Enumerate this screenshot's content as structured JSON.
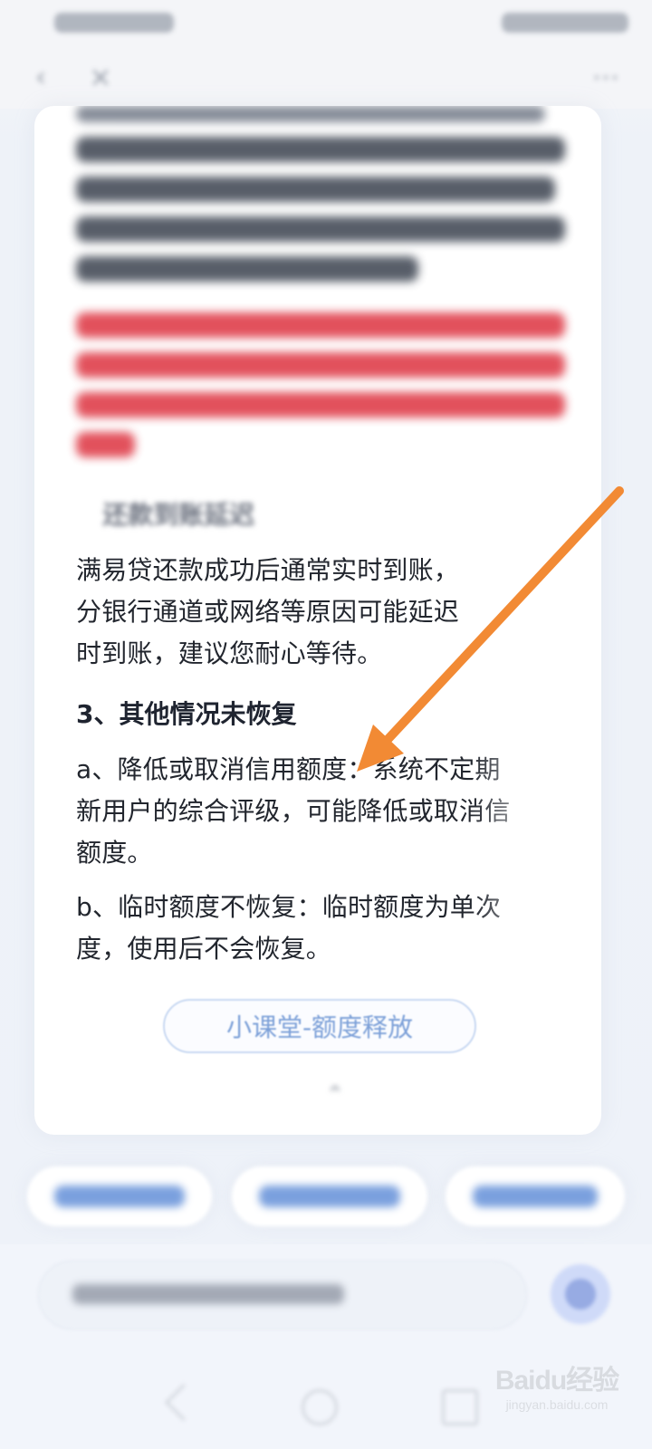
{
  "article": {
    "section_heading": "还款到账延迟",
    "delay_text": [
      "满易贷还款成功后通常实时到账，",
      "分银行通道或网络等原因可能延迟",
      "时到账，建议您耐心等待。"
    ],
    "other_heading": "3、其他情况未恢复",
    "items": [
      {
        "lines": [
          "a、降低或取消信用额度：系统不定期",
          "新用户的综合评级，可能降低或取消信",
          "额度。"
        ]
      },
      {
        "lines": [
          "b、临时额度不恢复：临时额度为单次",
          "度，使用后不会恢复。"
        ]
      }
    ],
    "pill_button": "小课堂-额度释放"
  },
  "watermark": {
    "logo": "Baidu经验",
    "sub": "jingyan.baidu.com"
  },
  "colors": {
    "accent_orange": "#f28a34",
    "link_blue": "#7ca0d8",
    "blurred_red": "#e13b4b"
  },
  "icons": {
    "back": "chevron-left-icon",
    "close": "close-icon",
    "more": "more-icon",
    "send": "send-icon",
    "system_back": "system-back-icon",
    "system_home": "system-home-icon",
    "system_recent": "system-recent-icon"
  }
}
